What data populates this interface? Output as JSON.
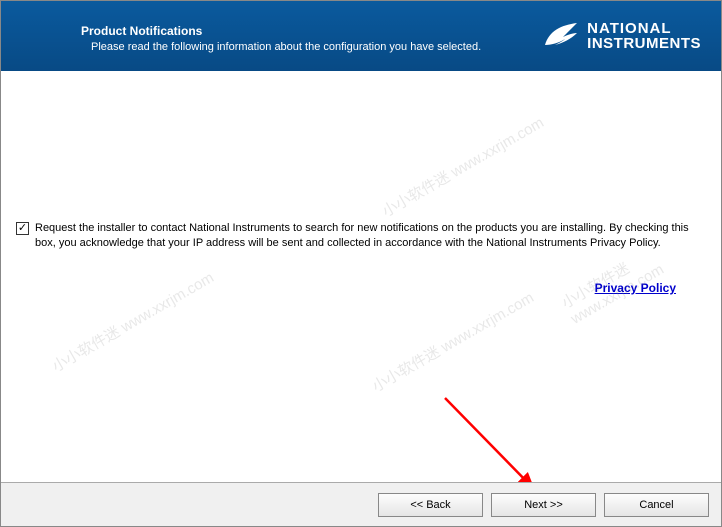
{
  "header": {
    "title": "Product Notifications",
    "subtitle": "Please read the following information about the configuration you have selected."
  },
  "brand": {
    "line1": "NATIONAL",
    "line2": "INSTRUMENTS"
  },
  "content": {
    "checkbox_label": "Request the installer to contact National Instruments to search for new notifications on the products you are installing. By checking this box, you acknowledge that your IP address will be sent and collected in accordance with the National Instruments Privacy Policy.",
    "checkbox_checked": true,
    "privacy_link_text": "Privacy Policy"
  },
  "footer": {
    "back_label": "<< Back",
    "next_label": "Next >>",
    "cancel_label": "Cancel"
  },
  "watermark": "小小软件迷 www.xxrjm.com"
}
